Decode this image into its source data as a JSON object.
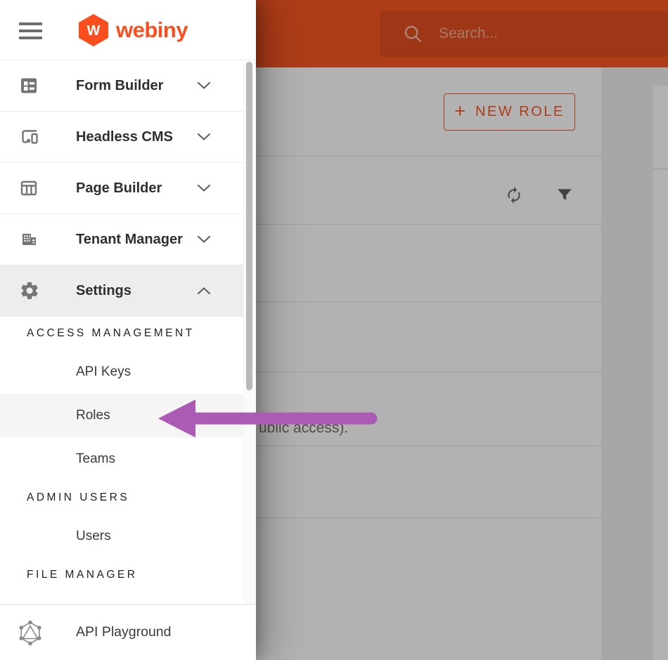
{
  "brand": {
    "name": "webiny",
    "logo_letter": "W"
  },
  "appbar": {
    "search_placeholder": "Search..."
  },
  "sidebar": {
    "items": [
      {
        "label": "Form Builder",
        "icon": "form-builder-icon",
        "state": "collapsed"
      },
      {
        "label": "Headless CMS",
        "icon": "headless-cms-icon",
        "state": "collapsed"
      },
      {
        "label": "Page Builder",
        "icon": "page-builder-icon",
        "state": "collapsed"
      },
      {
        "label": "Tenant Manager",
        "icon": "tenant-manager-icon",
        "state": "collapsed"
      },
      {
        "label": "Settings",
        "icon": "settings-icon",
        "state": "expanded"
      }
    ],
    "settings_submenu": {
      "sections": [
        {
          "header": "ACCESS MANAGEMENT",
          "items": [
            {
              "label": "API Keys"
            },
            {
              "label": "Roles",
              "highlighted": true
            },
            {
              "label": "Teams"
            }
          ]
        },
        {
          "header": "ADMIN USERS",
          "items": [
            {
              "label": "Users"
            }
          ]
        },
        {
          "header": "FILE MANAGER",
          "items": []
        }
      ]
    },
    "footer": {
      "label": "API Playground",
      "icon": "graphql-icon"
    }
  },
  "main": {
    "new_role_button": {
      "plus": "+",
      "label": "NEW ROLE"
    },
    "toolbar_icons": [
      "refresh-icon",
      "filter-icon"
    ],
    "list": {
      "visible_text_fragment": "ublic access)."
    }
  },
  "annotation": {
    "type": "arrow",
    "points_at": "Roles",
    "color": "#AC5BB5"
  },
  "colors": {
    "accent": "#FA5723",
    "appbar": "#FA5723",
    "selected_row": "#F5F5F5",
    "arrow": "#AC5BB5"
  }
}
